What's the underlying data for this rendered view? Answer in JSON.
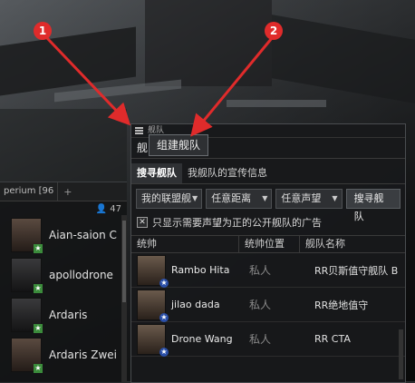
{
  "chat": {
    "tab_label": "perium [96",
    "add_tab": "+",
    "member_count": "47",
    "members": [
      {
        "name": "Aian-saion C"
      },
      {
        "name": "apollodrone"
      },
      {
        "name": "Ardaris"
      },
      {
        "name": "Ardaris Zwei"
      }
    ]
  },
  "fleet": {
    "window_title": "舰队",
    "header_title": "舰队搜寻器",
    "tooltip": "组建舰队",
    "tabs": [
      "搜寻舰队",
      "我舰队的宣传信息"
    ],
    "filters": {
      "scope": "我的联盟舰",
      "distance": "任意距离",
      "standing": "任意声望",
      "search_button": "搜寻舰队"
    },
    "checkbox_label": "只显示需要声望为正的公开舰队的广告",
    "columns": [
      "统帅",
      "统帅位置",
      "舰队名称"
    ],
    "rows": [
      {
        "boss": "Rambo Hita",
        "location": "私人",
        "fleet_name": "RR贝斯值守舰队 B"
      },
      {
        "boss": "jilao dada",
        "location": "私人",
        "fleet_name": "RR绝地值守"
      },
      {
        "boss": "Drone Wang",
        "location": "私人",
        "fleet_name": "RR CTA"
      }
    ]
  },
  "annotations": {
    "marker1": "1",
    "marker2": "2",
    "color": "#e02b2b"
  }
}
